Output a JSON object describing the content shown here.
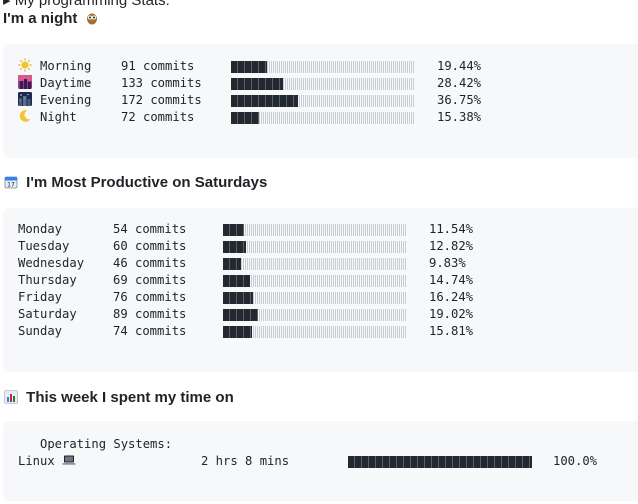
{
  "top_line": "▸  My programming Stats:",
  "night": {
    "heading": "I'm a night",
    "heading_icon": "owl-icon",
    "rows": [
      {
        "icon": "sun-icon",
        "glyph": "🌞",
        "label": "Morning",
        "commits": "91 commits",
        "percent": "19.44%",
        "value": 19.44
      },
      {
        "icon": "city-dusk-icon",
        "glyph": "🌆",
        "label": "Daytime",
        "commits": "133 commits",
        "percent": "28.42%",
        "value": 28.42
      },
      {
        "icon": "city-night-icon",
        "glyph": "🌃",
        "label": "Evening",
        "commits": "172 commits",
        "percent": "36.75%",
        "value": 36.75
      },
      {
        "icon": "moon-icon",
        "glyph": "🌙",
        "label": "Night",
        "commits": "72 commits",
        "percent": "15.38%",
        "value": 15.38
      }
    ]
  },
  "productive": {
    "heading": "I'm Most Productive on Saturdays",
    "heading_icon": "calendar-icon",
    "rows": [
      {
        "label": "Monday",
        "commits": "54 commits",
        "percent": "11.54%",
        "value": 11.54
      },
      {
        "label": "Tuesday",
        "commits": "60 commits",
        "percent": "12.82%",
        "value": 12.82
      },
      {
        "label": "Wednesday",
        "commits": "46 commits",
        "percent": "9.83%",
        "value": 9.83
      },
      {
        "label": "Thursday",
        "commits": "69 commits",
        "percent": "14.74%",
        "value": 14.74
      },
      {
        "label": "Friday",
        "commits": "76 commits",
        "percent": "16.24%",
        "value": 16.24
      },
      {
        "label": "Saturday",
        "commits": "89 commits",
        "percent": "19.02%",
        "value": 19.02
      },
      {
        "label": "Sunday",
        "commits": "74 commits",
        "percent": "15.81%",
        "value": 15.81
      }
    ]
  },
  "week": {
    "heading": "This week I spent my time on",
    "heading_icon": "bar-chart-icon",
    "section_label": "Operating Systems:",
    "section_icon": "laptop-icon",
    "rows": [
      {
        "label": "Linux",
        "time": "2 hrs 8 mins",
        "percent": "100.0%",
        "value": 100.0
      }
    ]
  }
}
